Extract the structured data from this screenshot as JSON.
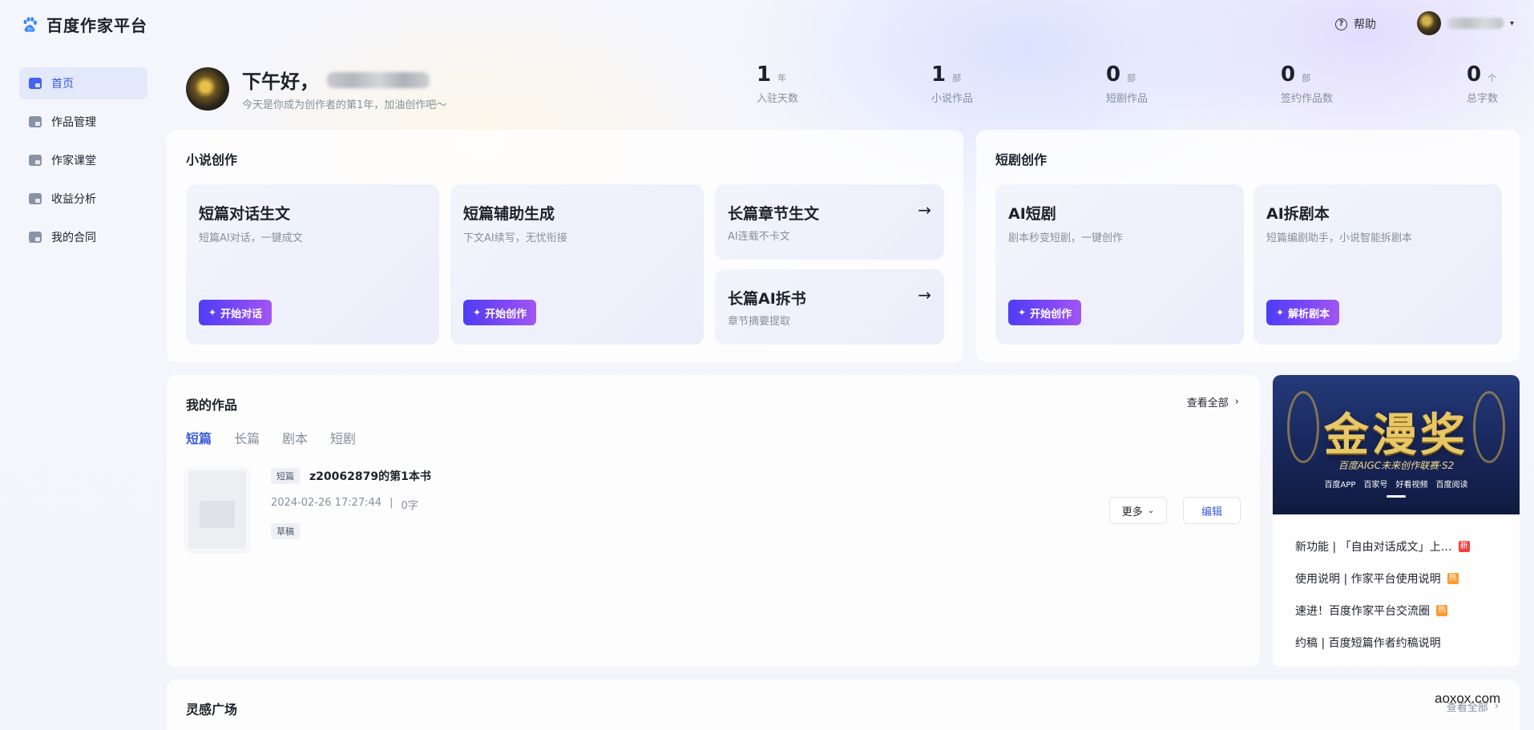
{
  "header": {
    "app_name": "百度作家平台",
    "help_label": "帮助"
  },
  "sidebar": {
    "items": [
      {
        "label": "首页"
      },
      {
        "label": "作品管理"
      },
      {
        "label": "作家课堂"
      },
      {
        "label": "收益分析"
      },
      {
        "label": "我的合同"
      }
    ]
  },
  "greeting": {
    "hello": "下午好，",
    "subtitle": "今天是你成为创作者的第1年，加油创作吧〜"
  },
  "stats": [
    {
      "value": "1",
      "unit": "年",
      "label": "入驻天数"
    },
    {
      "value": "1",
      "unit": "部",
      "label": "小说作品"
    },
    {
      "value": "0",
      "unit": "部",
      "label": "短剧作品"
    },
    {
      "value": "0",
      "unit": "部",
      "label": "签约作品数"
    },
    {
      "value": "0",
      "unit": "个",
      "label": "总字数"
    }
  ],
  "novel": {
    "title": "小说创作",
    "cards": [
      {
        "title": "短篇对话生文",
        "desc": "短篇AI对话，一键成文",
        "button": "开始对话"
      },
      {
        "title": "短篇辅助生成",
        "desc": "下文AI续写，无忧衔接",
        "button": "开始创作"
      },
      {
        "title": "长篇章节生文",
        "desc": "AI连载不卡文"
      },
      {
        "title": "长篇AI拆书",
        "desc": "章节摘要提取"
      }
    ]
  },
  "drama": {
    "title": "短剧创作",
    "cards": [
      {
        "title": "AI短剧",
        "desc": "剧本秒变短剧，一键创作",
        "button": "开始创作"
      },
      {
        "title": "AI拆剧本",
        "desc": "短篇编剧助手，小说智能拆剧本",
        "button": "解析剧本"
      }
    ]
  },
  "works": {
    "title": "我的作品",
    "view_all": "查看全部",
    "tabs": [
      "短篇",
      "长篇",
      "剧本",
      "短剧"
    ],
    "item": {
      "tag": "短篇",
      "name": "z20062879的第1本书",
      "date": "2024-02-26 17:27:44",
      "words": "0字",
      "status": "草稿",
      "more": "更多",
      "edit": "编辑"
    }
  },
  "banner": {
    "title": "金漫奖",
    "subtitle": "百度AIGC未来创作联赛·S2",
    "logos": [
      "百度APP",
      "百家号",
      "好看视频",
      "百度阅读"
    ]
  },
  "news": [
    {
      "text": "新功能 | 「自由对话成文」上…",
      "badge": "新",
      "badge_type": "new"
    },
    {
      "text": "使用说明 | 作家平台使用说明",
      "badge": "热",
      "badge_type": "hot"
    },
    {
      "text": "速进！百度作家平台交流圈",
      "badge": "热",
      "badge_type": "hot"
    },
    {
      "text": "约稿 | 百度短篇作者约稿说明",
      "badge": "",
      "badge_type": ""
    }
  ],
  "inspiration": {
    "title": "灵感广场",
    "view_all": "查看全部"
  },
  "watermark": "aoxox.com"
}
